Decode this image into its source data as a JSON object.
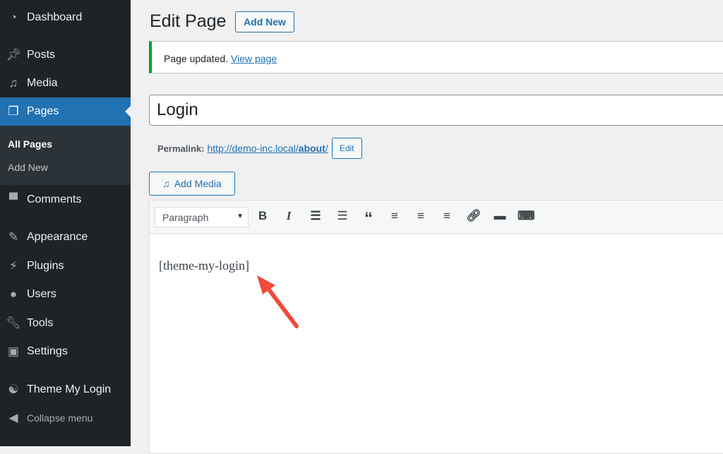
{
  "sidebar": {
    "items": [
      {
        "label": "Dashboard",
        "icon": "dashboard-icon"
      },
      {
        "label": "Posts",
        "icon": "pin-icon"
      },
      {
        "label": "Media",
        "icon": "media-icon"
      },
      {
        "label": "Pages",
        "icon": "pages-icon"
      },
      {
        "label": "Comments",
        "icon": "comment-icon"
      },
      {
        "label": "Appearance",
        "icon": "brush-icon"
      },
      {
        "label": "Plugins",
        "icon": "plugin-icon"
      },
      {
        "label": "Users",
        "icon": "user-icon"
      },
      {
        "label": "Tools",
        "icon": "wrench-icon"
      },
      {
        "label": "Settings",
        "icon": "settings-icon"
      },
      {
        "label": "Theme My Login",
        "icon": "theme-my-login-icon"
      }
    ],
    "submenu": [
      "All Pages",
      "Add New"
    ],
    "collapse": "Collapse menu"
  },
  "header": {
    "title": "Edit Page",
    "add_new": "Add New"
  },
  "notice": {
    "text": "Page updated.",
    "link": "View page"
  },
  "post": {
    "title": "Login",
    "permalink_label": "Permalink:",
    "permalink_base": "http://demo-inc.local/",
    "permalink_slug": "about",
    "permalink_end": "/",
    "edit": "Edit"
  },
  "editor": {
    "add_media": "Add Media",
    "format": "Paragraph",
    "content": "[theme-my-login]"
  },
  "colors": {
    "accent": "#2271b1",
    "sidebar": "#1d2327",
    "success": "#00a32a",
    "arrow": "#f04a3a"
  }
}
